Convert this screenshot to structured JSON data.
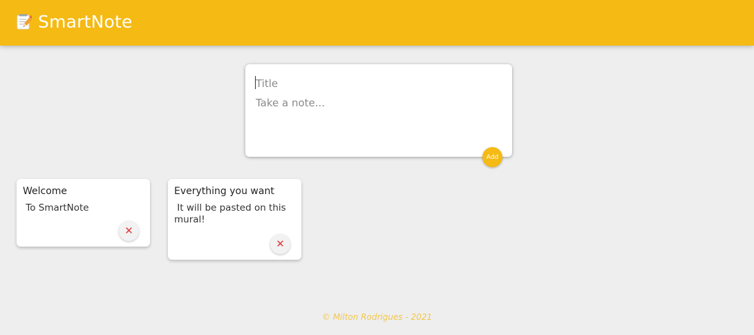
{
  "header": {
    "app_name": "SmartNote",
    "logo_icon": "memo-pencil-icon",
    "background_color": "#f5ba13"
  },
  "create_note": {
    "title_placeholder": "Title",
    "title_value": "",
    "content_placeholder": "Take a note...",
    "content_value": "",
    "add_label": "Add"
  },
  "notes": [
    {
      "title": "Welcome",
      "content": " To SmartNote",
      "delete_icon": "close-icon",
      "delete_symbol": "✕"
    },
    {
      "title": "Everything you want",
      "content": " It will be pasted on this\nmural!",
      "delete_icon": "close-icon",
      "delete_symbol": "✕"
    }
  ],
  "footer": {
    "text": "© Milton Rodrigues - 2021"
  },
  "colors": {
    "accent": "#f5ba13",
    "background": "#eeeeee",
    "delete": "#e0393e"
  }
}
